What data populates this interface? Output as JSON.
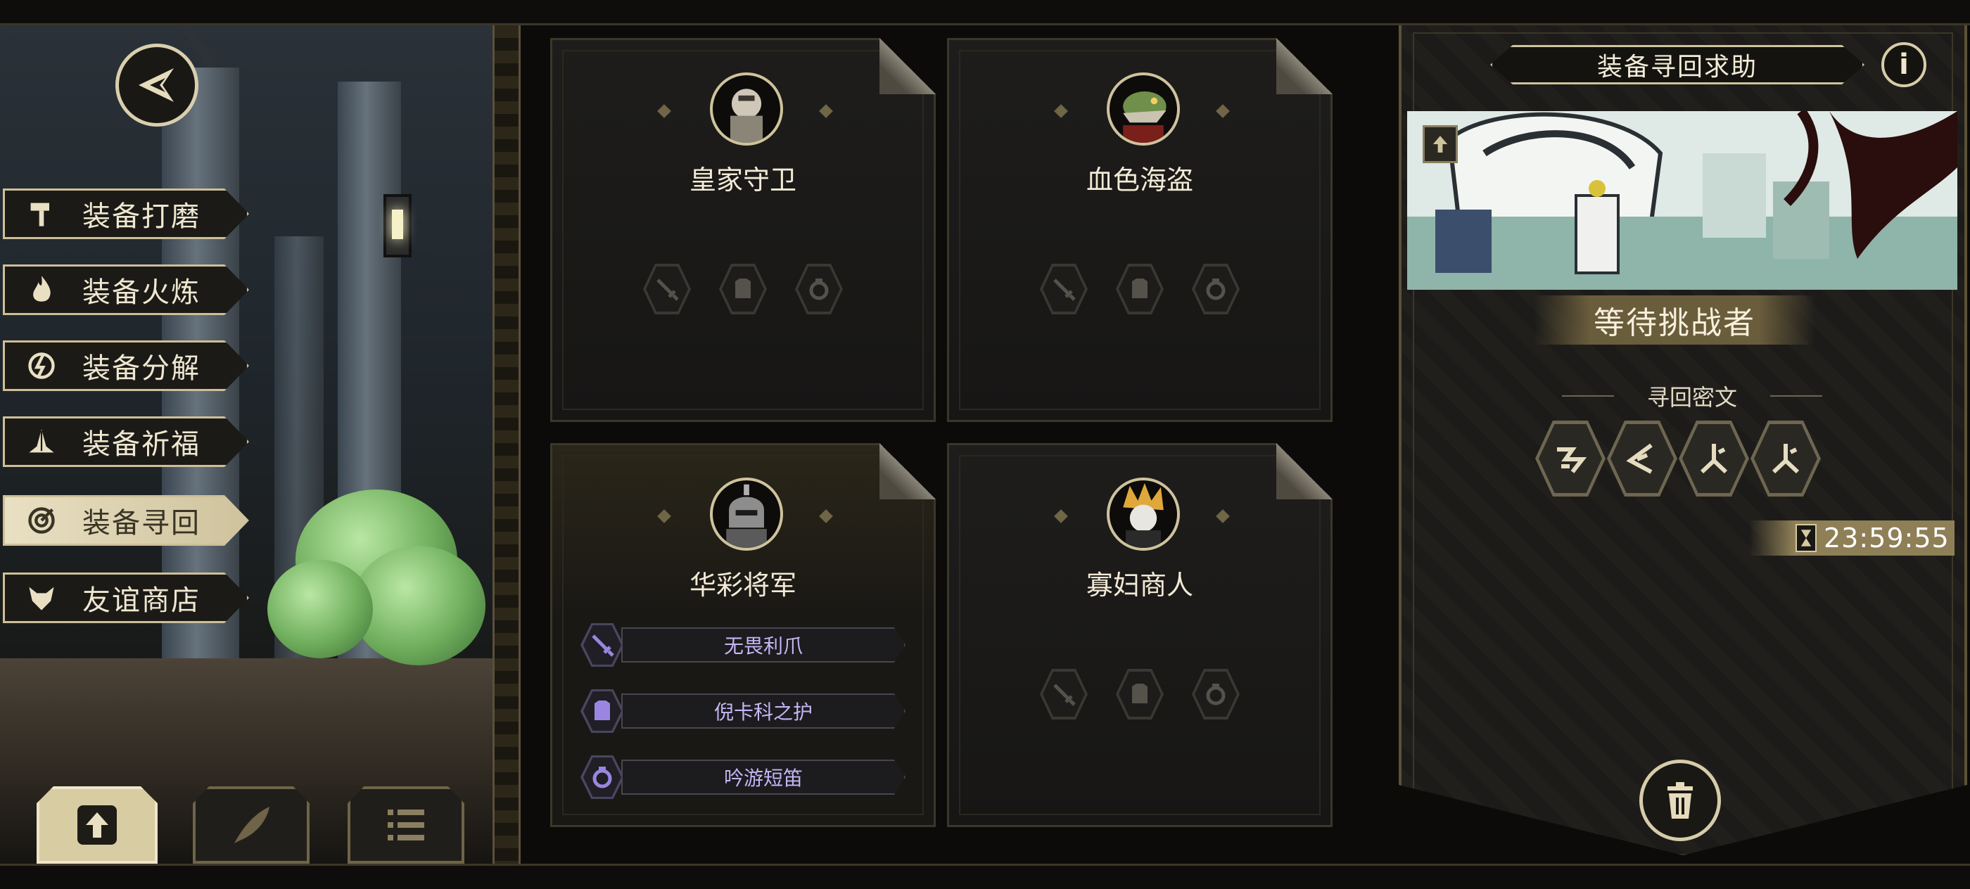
{
  "menu": {
    "items": [
      {
        "label": "装备打磨",
        "icon": "hammer-icon"
      },
      {
        "label": "装备火炼",
        "icon": "flame-icon"
      },
      {
        "label": "装备分解",
        "icon": "disassemble-icon"
      },
      {
        "label": "装备祈福",
        "icon": "pray-hands-icon"
      },
      {
        "label": "装备寻回",
        "icon": "retrieve-icon",
        "active": true
      },
      {
        "label": "友谊商店",
        "icon": "fox-icon"
      }
    ]
  },
  "cards": [
    {
      "name": "皇家守卫",
      "portrait": "royal-guard-portrait",
      "slots": [
        "sword-icon",
        "armor-icon",
        "ring-icon"
      ]
    },
    {
      "name": "血色海盗",
      "portrait": "crimson-pirate-portrait",
      "slots": [
        "sword-icon",
        "armor-icon",
        "ring-icon"
      ]
    },
    {
      "name": "华彩将军",
      "portrait": "resplendent-general-portrait",
      "equipment": [
        {
          "name": "无畏利爪",
          "icon": "sword-icon"
        },
        {
          "name": "倪卡科之护",
          "icon": "armor-icon"
        },
        {
          "name": "吟游短笛",
          "icon": "ring-icon"
        }
      ]
    },
    {
      "name": "寡妇商人",
      "portrait": "widow-merchant-portrait",
      "slots": [
        "sword-icon",
        "armor-icon",
        "ring-icon"
      ]
    }
  ],
  "right_panel": {
    "title": "装备寻回求助",
    "info_label": "i",
    "status": "等待挑战者",
    "cipher_title": "寻回密文",
    "runes": [
      "rune-1-icon",
      "rune-2-icon",
      "rune-3-icon",
      "rune-3-icon"
    ],
    "timer": "23:59:55"
  },
  "colors": {
    "accent_gold": "#cfc39d",
    "equipment_purple": "#c6b6f5",
    "panel_dark": "#1c1b19"
  }
}
